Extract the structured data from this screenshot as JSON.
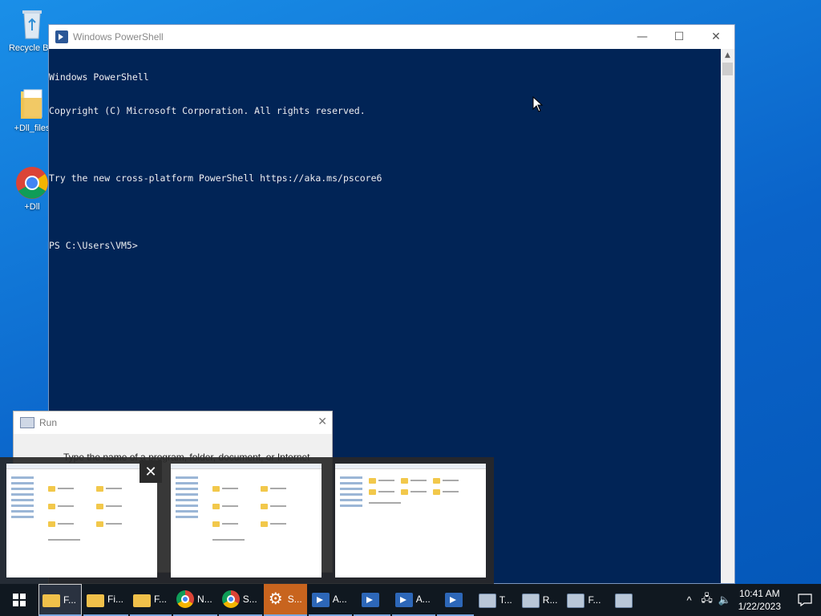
{
  "desktop": {
    "icons": [
      {
        "label": "Recycle Bin"
      },
      {
        "label": "+Dll_files"
      },
      {
        "label": "+Dll"
      }
    ]
  },
  "powershell": {
    "title": "Windows PowerShell",
    "lines": [
      "Windows PowerShell",
      "Copyright (C) Microsoft Corporation. All rights reserved.",
      "",
      "Try the new cross-platform PowerShell https://aka.ms/pscore6",
      "",
      "PS C:\\Users\\VM5>"
    ],
    "minimize": "—",
    "maximize": "☐",
    "close": "✕",
    "colors": {
      "background": "#012456",
      "text": "#eeedf0"
    }
  },
  "run_dialog": {
    "title": "Run",
    "close": "✕",
    "description": "Type the name of a program, folder, document, or Internet"
  },
  "thumbnails": {
    "close": "✕",
    "count": 3
  },
  "taskbar": {
    "items": [
      {
        "label": "F...",
        "icon": "folder-icon"
      },
      {
        "label": "Fi...",
        "icon": "folder-icon"
      },
      {
        "label": "F...",
        "icon": "folder-icon"
      },
      {
        "label": "N...",
        "icon": "chrome-icon"
      },
      {
        "label": "S...",
        "icon": "chrome-icon"
      },
      {
        "label": "S...",
        "icon": "gear-icon"
      },
      {
        "label": "A...",
        "icon": "powershell-icon"
      },
      {
        "label": "",
        "icon": "powershell-icon"
      },
      {
        "label": "A...",
        "icon": "powershell-icon"
      },
      {
        "label": "",
        "icon": "powershell-icon"
      },
      {
        "label": "T...",
        "icon": "app-icon"
      },
      {
        "label": "R...",
        "icon": "app-icon"
      },
      {
        "label": "F...",
        "icon": "app-icon"
      },
      {
        "label": "",
        "icon": "app-icon"
      }
    ],
    "clock_time": "10:41 AM",
    "clock_date": "1/22/2023",
    "tray": {
      "chevron": "^",
      "network": "🖧",
      "volume": "🔈"
    }
  }
}
